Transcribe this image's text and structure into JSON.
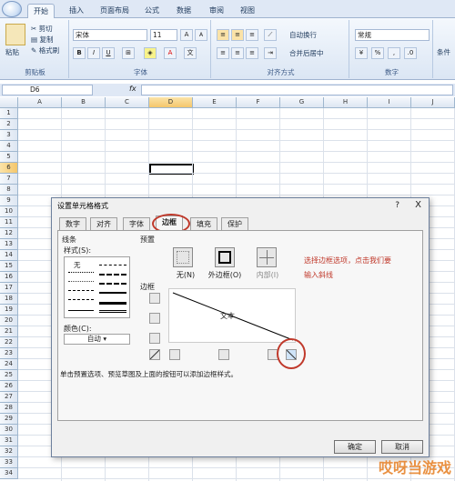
{
  "ribbon_tabs": [
    "开始",
    "插入",
    "页面布局",
    "公式",
    "数据",
    "审阅",
    "视图"
  ],
  "clipboard": {
    "paste": "粘贴",
    "cut": "剪切",
    "copy": "复制",
    "format_painter": "格式刷",
    "label": "剪贴板"
  },
  "font": {
    "name": "宋体",
    "size": "11",
    "label": "字体",
    "bold": "B",
    "italic": "I",
    "underline": "U",
    "grow": "A",
    "shrink": "A",
    "color_a": "A"
  },
  "alignment": {
    "wrap": "自动换行",
    "merge": "合并后居中",
    "label": "对齐方式"
  },
  "number": {
    "format": "常规",
    "percent": "%",
    "comma": ",",
    "label": "数字"
  },
  "styles": {
    "label": "条件"
  },
  "formula_bar": {
    "cell_ref": "D6",
    "fx": "fx"
  },
  "columns": [
    "A",
    "B",
    "C",
    "D",
    "E",
    "F",
    "G",
    "H",
    "I",
    "J"
  ],
  "rows": [
    "1",
    "2",
    "3",
    "4",
    "5",
    "6",
    "7",
    "8",
    "9",
    "10",
    "11",
    "12",
    "13",
    "14",
    "15",
    "16",
    "17",
    "18",
    "19",
    "20",
    "21",
    "22",
    "23",
    "24",
    "25",
    "26",
    "27",
    "28",
    "29",
    "30",
    "31",
    "32",
    "33",
    "34"
  ],
  "dialog": {
    "title": "设置单元格格式",
    "help": "?",
    "close": "X",
    "tabs": [
      "数字",
      "对齐",
      "字体",
      "边框",
      "填充",
      "保护"
    ],
    "line_section": "线条",
    "style_label": "样式(S):",
    "none": "无",
    "color_label": "颜色(C):",
    "color_value": "自动",
    "preset_label": "预置",
    "preset_none": "无(N)",
    "preset_outline": "外边框(O)",
    "preset_inside": "内部(I)",
    "border_label": "边框",
    "preview_text": "文本",
    "hint": "单击预置选项、预览草图及上面的按钮可以添加边框样式。",
    "ok": "确定",
    "cancel": "取消"
  },
  "annotation": {
    "line1": "选择边框选项，点击我们要",
    "line2": "输入斜线"
  },
  "watermark": "哎呀当游戏",
  "colors": {
    "accent": "#c0392b",
    "ribbon": "#dfe8f5",
    "header_sel": "#f4c66b"
  }
}
